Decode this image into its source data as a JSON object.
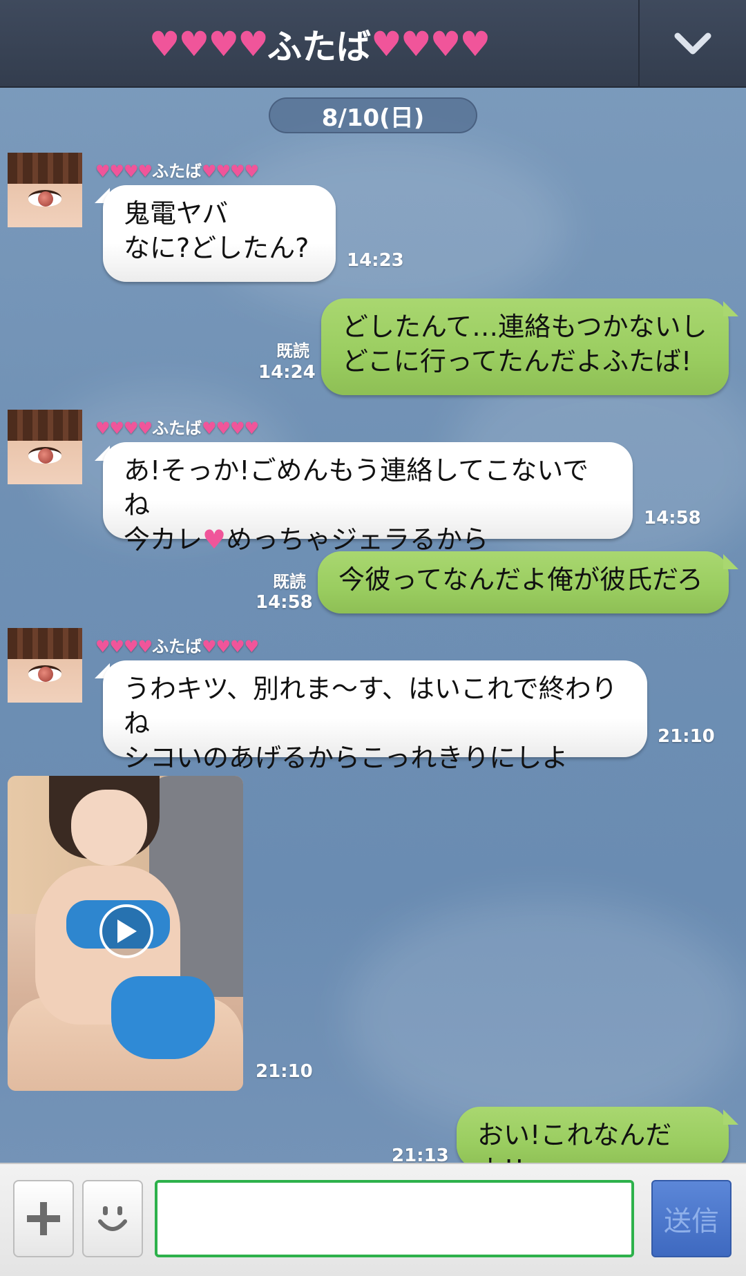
{
  "header": {
    "hearts_left": "♥♥♥♥",
    "name": "ふたば",
    "hearts_right": "♥♥♥♥",
    "toggle_icon": "chevron-down-icon"
  },
  "date_label": "8/10(日)",
  "sender": {
    "hearts_left": "♥♥♥♥",
    "name": "ふたば",
    "hearts_right": "♥♥♥♥"
  },
  "messages": [
    {
      "text": "鬼電ヤバ\nなに?どしたん?",
      "time": "14:23"
    },
    {
      "text": "どしたんて…連絡もつかないし\nどこに行ってたんだよふたば!",
      "read": "既読",
      "time": "14:24"
    },
    {
      "text_before": "あ!そっか!ごめんもう連絡してこないでね\n今カレ",
      "heart": "♥",
      "text_after": "めっちゃジェラるから",
      "time": "14:58"
    },
    {
      "text": "今彼ってなんだよ俺が彼氏だろ",
      "read": "既読",
      "time": "14:58"
    },
    {
      "text": "うわキツ、別れま〜す、はいこれで終わりね\nシコいのあげるからこっれきりにしよ",
      "time": "21:10"
    },
    {
      "video_icon": "play-icon",
      "time": "21:10"
    },
    {
      "text": "おい!これなんだよ!!",
      "time": "21:13"
    }
  ],
  "input_bar": {
    "plus_icon": "plus-icon",
    "emoji_icon": "smiley-icon",
    "input_value": "",
    "send_label": "送信"
  },
  "colors": {
    "header_bg": "#3a4456",
    "heart": "#f0559a",
    "outgoing_bubble": "#9acd60",
    "incoming_bubble": "#ffffff",
    "send_button": "#4a76cc",
    "input_border": "#2db14b"
  }
}
